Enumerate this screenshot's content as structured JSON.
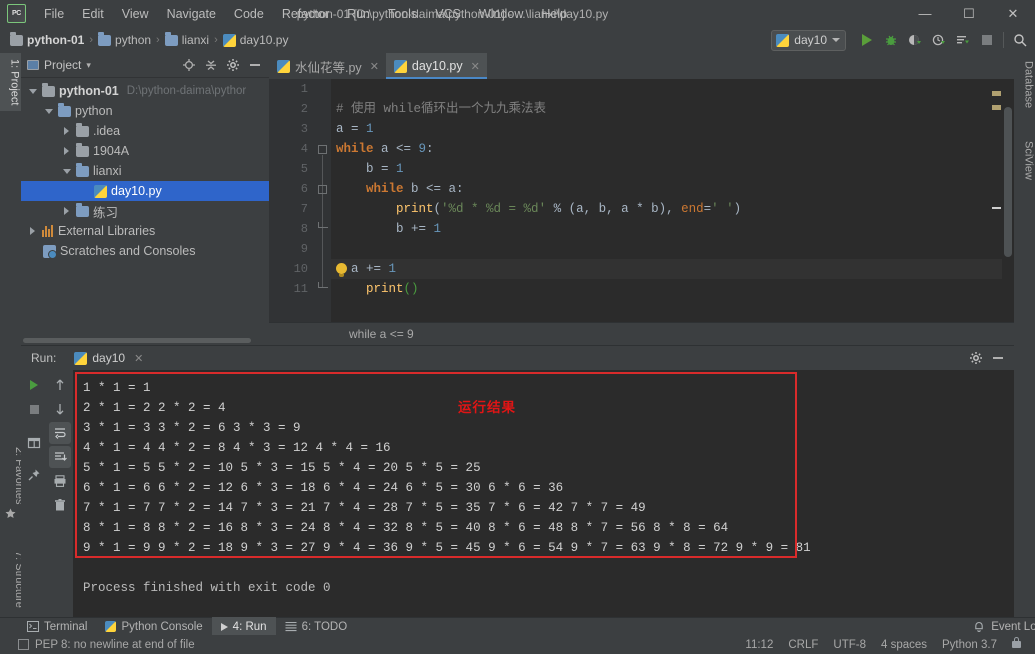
{
  "window": {
    "title": "python-01 [D:\\python-daima\\python-01] - ...\\lianxi\\day10.py",
    "logo_text": "PC",
    "minimize": "—",
    "maximize": "☐",
    "close": "✕"
  },
  "menu": {
    "items": [
      "File",
      "Edit",
      "View",
      "Navigate",
      "Code",
      "Refactor",
      "Run",
      "Tools",
      "VCS",
      "Window",
      "Help"
    ]
  },
  "breadcrumb": {
    "items": [
      {
        "label": "python-01",
        "icon": "folder-icon",
        "bold": true
      },
      {
        "label": "python",
        "icon": "folder-icon",
        "bold": false
      },
      {
        "label": "lianxi",
        "icon": "folder-icon",
        "bold": false
      },
      {
        "label": "day10.py",
        "icon": "python-file-icon",
        "bold": false
      }
    ],
    "separator": "›"
  },
  "toolbar": {
    "run_config": "day10",
    "buttons": [
      "run",
      "debug",
      "coverage",
      "profile",
      "run-with-console",
      "stop",
      "search"
    ]
  },
  "left_strip": {
    "project_tab": "1: Project",
    "favorites_tab": "2: Favorites",
    "structure_tab": "7: Structure"
  },
  "right_strip": {
    "database_tab": "Database",
    "sciview_tab": "SciView"
  },
  "project_panel": {
    "title": "Project",
    "caret": "▾",
    "tools": [
      "locate-icon",
      "collapse-all-icon",
      "settings-icon",
      "hide-icon"
    ],
    "tree": [
      {
        "indent": 0,
        "twisty": "down",
        "icon": "folder-icon",
        "label": "python-01",
        "bold": true,
        "path": "D:\\python-daima\\pythor",
        "selected": false
      },
      {
        "indent": 1,
        "twisty": "down",
        "icon": "folder-blue-icon",
        "label": "python",
        "bold": false,
        "path": "",
        "selected": false
      },
      {
        "indent": 2,
        "twisty": "right",
        "icon": "folder-icon",
        "label": ".idea",
        "bold": false,
        "path": "",
        "selected": false
      },
      {
        "indent": 2,
        "twisty": "right",
        "icon": "folder-icon",
        "label": "1904A",
        "bold": false,
        "path": "",
        "selected": false
      },
      {
        "indent": 2,
        "twisty": "down",
        "icon": "folder-blue-icon",
        "label": "lianxi",
        "bold": false,
        "path": "",
        "selected": false
      },
      {
        "indent": 3,
        "twisty": "none",
        "icon": "python-file-icon",
        "label": "day10.py",
        "bold": false,
        "path": "",
        "selected": true
      },
      {
        "indent": 2,
        "twisty": "right",
        "icon": "folder-blue-icon",
        "label": "练习",
        "bold": false,
        "path": "",
        "selected": false
      },
      {
        "indent": 0,
        "twisty": "right",
        "icon": "library-icon",
        "label": "External Libraries",
        "bold": false,
        "path": "",
        "selected": false
      },
      {
        "indent": 0,
        "twisty": "none",
        "icon": "scratches-icon",
        "label": "Scratches and Consoles",
        "bold": false,
        "path": "",
        "selected": false
      }
    ]
  },
  "editor": {
    "tabs": [
      {
        "label": "水仙花等.py",
        "active": false,
        "close": "✕"
      },
      {
        "label": "day10.py",
        "active": true,
        "close": "✕"
      }
    ],
    "line_numbers": [
      "1",
      "2",
      "3",
      "4",
      "5",
      "6",
      "7",
      "8",
      "9",
      "10",
      "11"
    ],
    "lines": [
      {
        "n": 1,
        "text": ""
      },
      {
        "n": 2,
        "text": "# 使用 while循环出一个九九乘法表"
      },
      {
        "n": 3,
        "text": "a = 1"
      },
      {
        "n": 4,
        "text": "while a <= 9:"
      },
      {
        "n": 5,
        "text": "    b = 1"
      },
      {
        "n": 6,
        "text": "    while b <= a:"
      },
      {
        "n": 7,
        "text": "        print('%d * %d = %d' % (a, b, a * b), end=' ')"
      },
      {
        "n": 8,
        "text": "        b += 1"
      },
      {
        "n": 9,
        "text": ""
      },
      {
        "n": 10,
        "text": "    a += 1"
      },
      {
        "n": 11,
        "text": "    print()"
      }
    ],
    "breadcrumb_text": "while a <= 9"
  },
  "run_panel": {
    "label": "Run:",
    "tab_label": "day10",
    "tab_close": "✕",
    "settings_icon": "gear-icon",
    "hide_icon": "hide-icon",
    "side_buttons": [
      "rerun-icon",
      "stop-icon",
      "print-layout-icon",
      "pin-icon"
    ],
    "side_buttons2": [
      "scroll-up-icon",
      "scroll-down-icon",
      "soft-wrap-icon",
      "scroll-to-end-icon",
      "print-icon",
      "clear-all-icon"
    ],
    "console_output": [
      "1 * 1 = 1 ",
      "2 * 1 = 2 2 * 2 = 4 ",
      "3 * 1 = 3 3 * 2 = 6 3 * 3 = 9 ",
      "4 * 1 = 4 4 * 2 = 8 4 * 3 = 12 4 * 4 = 16 ",
      "5 * 1 = 5 5 * 2 = 10 5 * 3 = 15 5 * 4 = 20 5 * 5 = 25 ",
      "6 * 1 = 6 6 * 2 = 12 6 * 3 = 18 6 * 4 = 24 6 * 5 = 30 6 * 6 = 36 ",
      "7 * 1 = 7 7 * 2 = 14 7 * 3 = 21 7 * 4 = 28 7 * 5 = 35 7 * 6 = 42 7 * 7 = 49 ",
      "8 * 1 = 8 8 * 2 = 16 8 * 3 = 24 8 * 4 = 32 8 * 5 = 40 8 * 6 = 48 8 * 7 = 56 8 * 8 = 64 ",
      "9 * 1 = 9 9 * 2 = 18 9 * 3 = 27 9 * 4 = 36 9 * 5 = 45 9 * 6 = 54 9 * 7 = 63 9 * 8 = 72 9 * 9 = 81 "
    ],
    "process_finished": "Process finished with exit code 0",
    "annotation": "运行结果",
    "annotation_color": "#e01515"
  },
  "bottom_tool_window": {
    "items": [
      {
        "label": "Terminal",
        "icon": "terminal-icon",
        "active": false,
        "mnemonic": ""
      },
      {
        "label": "Python Console",
        "icon": "python-console-icon",
        "active": false,
        "mnemonic": ""
      },
      {
        "label": "4: Run",
        "icon": "run-icon",
        "active": true,
        "mnemonic": "4"
      },
      {
        "label": "6: TODO",
        "icon": "todo-icon",
        "active": false,
        "mnemonic": "6"
      }
    ],
    "event_log": "Event Log",
    "event_log_icon": "bell-icon"
  },
  "status_bar": {
    "inspection_message": "PEP 8: no newline at end of file",
    "position": "11:12",
    "line_separator": "CRLF",
    "encoding": "UTF-8",
    "indent": "4 spaces",
    "interpreter": "Python 3.7",
    "lock_icon": "lock-icon",
    "trash_icon": "trash-icon"
  }
}
